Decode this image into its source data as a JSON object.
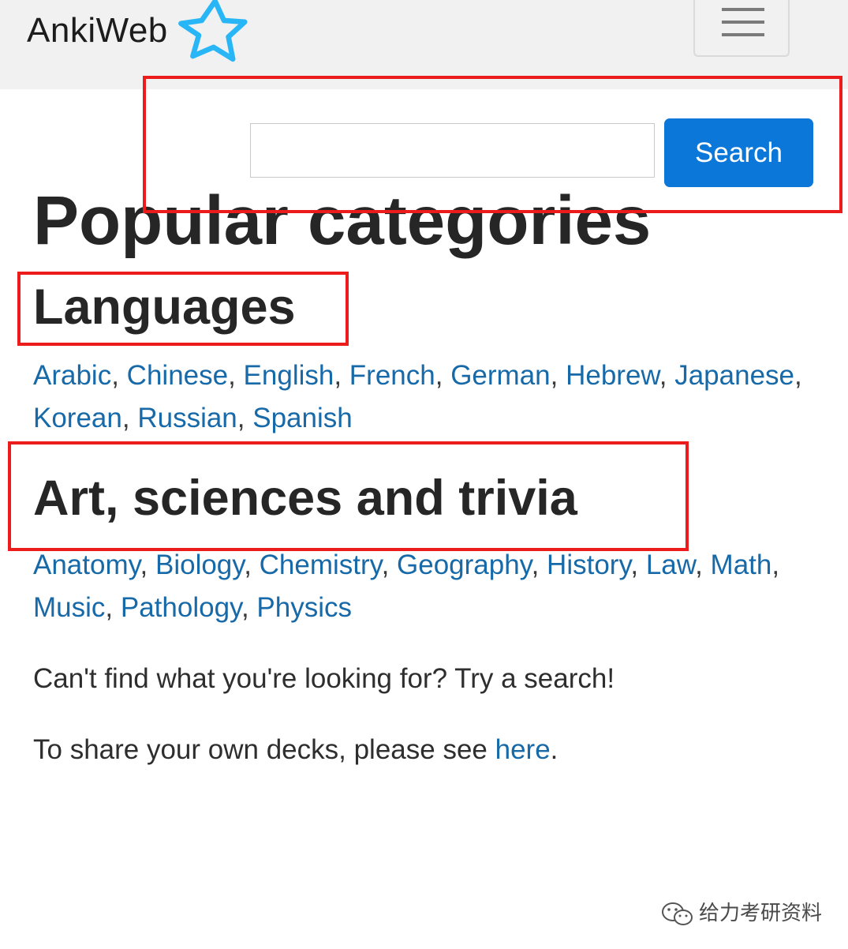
{
  "navbar": {
    "brand": "AnkiWeb",
    "logo_icon": "star-outline-icon",
    "menu_icon": "hamburger-menu-icon",
    "background": "#f1f1f1"
  },
  "search": {
    "input_value": "",
    "placeholder": "",
    "button_label": "Search",
    "button_color": "#0b77d9"
  },
  "main": {
    "title": "Popular categories",
    "sections": [
      {
        "heading": "Languages",
        "links": [
          "Arabic",
          "Chinese",
          "English",
          "French",
          "German",
          "Hebrew",
          "Japanese",
          "Korean",
          "Russian",
          "Spanish"
        ]
      },
      {
        "heading": "Art, sciences and trivia",
        "links": [
          "Anatomy",
          "Biology",
          "Chemistry",
          "Geography",
          "History",
          "Law",
          "Math",
          "Music",
          "Pathology",
          "Physics"
        ]
      }
    ],
    "hint_text": "Can't find what you're looking for? Try a search!",
    "share_prefix": "To share your own decks, please see ",
    "share_link": "here",
    "share_suffix": "."
  },
  "annotations": {
    "highlight_color": "#ec1c1c"
  },
  "watermark": {
    "text": "给力考研资料",
    "icon": "wechat-icon"
  },
  "colors": {
    "link": "#1769a8",
    "text": "#262626"
  }
}
